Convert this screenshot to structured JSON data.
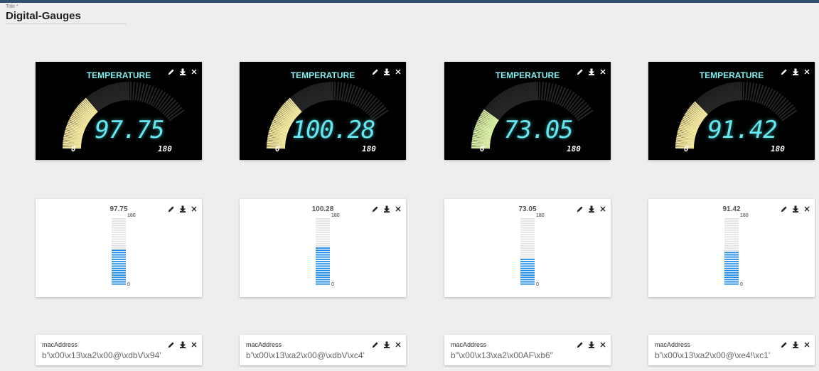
{
  "title": {
    "label": "Title *",
    "value": "Digital-Gauges"
  },
  "gauges": [
    {
      "title": "TEMPERATURE",
      "value": 97.75,
      "display": "97.75",
      "min": "0",
      "max": "180",
      "fill_color": "#f3e7a0"
    },
    {
      "title": "TEMPERATURE",
      "value": 100.28,
      "display": "100.28",
      "min": "0",
      "max": "180",
      "fill_color": "#f3e7a0"
    },
    {
      "title": "TEMPERATURE",
      "value": 73.05,
      "display": "73.05",
      "min": "0",
      "max": "180",
      "fill_color": "#d9efa6"
    },
    {
      "title": "TEMPERATURE",
      "value": 91.42,
      "display": "91.42",
      "min": "0",
      "max": "180",
      "fill_color": "#f3e7a0"
    }
  ],
  "bars": [
    {
      "value": 97.75,
      "display": "97.75",
      "min": "0",
      "max": "180"
    },
    {
      "value": 100.28,
      "display": "100.28",
      "min": "0",
      "max": "180"
    },
    {
      "value": 73.05,
      "display": "73.05",
      "min": "0",
      "max": "180"
    },
    {
      "value": 91.42,
      "display": "91.42",
      "min": "0",
      "max": "180"
    }
  ],
  "macs": [
    {
      "label": "macAddress",
      "value": "b'\\x00\\x13\\xa2\\x00@\\xdbV\\x94'"
    },
    {
      "label": "macAddress",
      "value": "b'\\x00\\x13\\xa2\\x00@\\xdbV\\xc4'"
    },
    {
      "label": "macAddress",
      "value": "b\"\\x00\\x13\\xa2\\x00AF\\xb6\""
    },
    {
      "label": "macAddress",
      "value": "b'\\x00\\x13\\xa2\\x00@\\xe4!\\xc1'"
    }
  ],
  "icons": {
    "edit": "pencil-icon",
    "download": "download-icon",
    "close": "close-icon"
  },
  "colors": {
    "header_bar": "#2f4f73",
    "bar_fill": "#1e88e5",
    "bar_empty": "#e3e3e3",
    "gauge_digits": "#63e8f0",
    "gauge_title": "#7ff0f0"
  }
}
